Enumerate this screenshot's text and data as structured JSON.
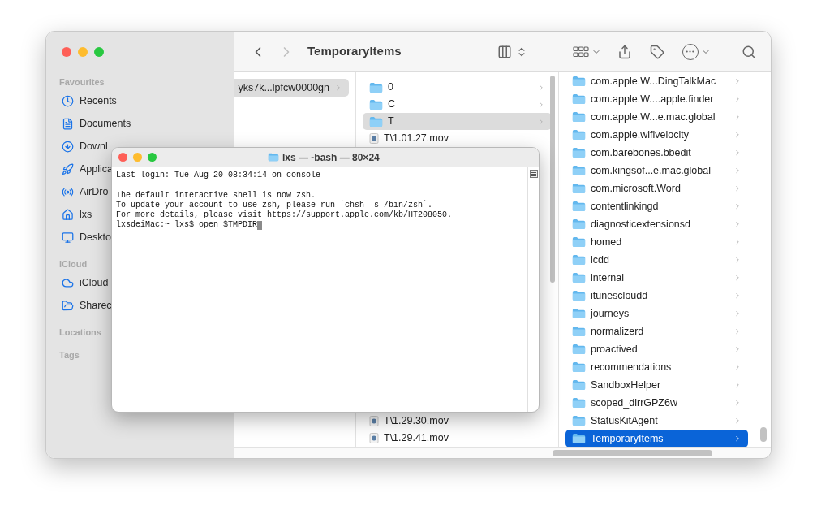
{
  "finder": {
    "title": "TemporaryItems",
    "forward_disabled": true,
    "sidebar": [
      {
        "heading": "Favourites",
        "items": [
          {
            "label": "Recents",
            "kind": "recents"
          },
          {
            "label": "Documents",
            "kind": "document"
          },
          {
            "label": "Downl",
            "kind": "download"
          },
          {
            "label": "Applica",
            "kind": "apps"
          },
          {
            "label": "AirDro",
            "kind": "airdrop"
          },
          {
            "label": "lxs",
            "kind": "home"
          },
          {
            "label": "Deskto",
            "kind": "desktop"
          }
        ]
      },
      {
        "heading": "iCloud",
        "items": [
          {
            "label": "iCloud",
            "kind": "cloud"
          },
          {
            "label": "Sharec",
            "kind": "shared"
          }
        ]
      },
      {
        "heading": "Locations"
      },
      {
        "heading": "Tags"
      }
    ],
    "columns": [
      {
        "focused": false,
        "top": [
          {
            "label": "yks7k...lpfcw0000gn",
            "kind": "path",
            "selected": true
          }
        ]
      },
      {
        "focused": false,
        "top": [
          {
            "label": "0",
            "kind": "folder",
            "selected": false
          },
          {
            "label": "C",
            "kind": "folder",
            "selected": false
          },
          {
            "label": "T",
            "kind": "folder",
            "selected": true
          },
          {
            "label": "T\\1.01.27.mov",
            "kind": "movie",
            "selected": false
          }
        ],
        "bottom": [
          {
            "label": "T\\1.29.30.mov",
            "kind": "movie",
            "selected": false
          },
          {
            "label": "T\\1.29.41.mov",
            "kind": "movie",
            "selected": false
          }
        ]
      },
      {
        "focused": true,
        "top": [
          {
            "label": "com.apple.W...DingTalkMac",
            "kind": "folder",
            "selected": false
          },
          {
            "label": "com.apple.W....apple.finder",
            "kind": "folder",
            "selected": false
          },
          {
            "label": "com.apple.W...e.mac.global",
            "kind": "folder",
            "selected": false
          },
          {
            "label": "com.apple.wifivelocity",
            "kind": "folder",
            "selected": false
          },
          {
            "label": "com.barebones.bbedit",
            "kind": "folder",
            "selected": false
          },
          {
            "label": "com.kingsof...e.mac.global",
            "kind": "folder",
            "selected": false
          },
          {
            "label": "com.microsoft.Word",
            "kind": "folder",
            "selected": false
          },
          {
            "label": "contentlinkingd",
            "kind": "folder",
            "selected": false
          },
          {
            "label": "diagnosticextensionsd",
            "kind": "folder",
            "selected": false
          },
          {
            "label": "homed",
            "kind": "folder",
            "selected": false
          },
          {
            "label": "icdd",
            "kind": "folder",
            "selected": false
          },
          {
            "label": "internal",
            "kind": "folder",
            "selected": false
          },
          {
            "label": "itunescloudd",
            "kind": "folder",
            "selected": false
          },
          {
            "label": "journeys",
            "kind": "folder",
            "selected": false
          },
          {
            "label": "normalizerd",
            "kind": "folder",
            "selected": false
          },
          {
            "label": "proactived",
            "kind": "folder",
            "selected": false
          },
          {
            "label": "recommendations",
            "kind": "folder",
            "selected": false
          },
          {
            "label": "SandboxHelper",
            "kind": "folder",
            "selected": false
          },
          {
            "label": "scoped_dirrGPZ6w",
            "kind": "folder",
            "selected": false
          },
          {
            "label": "StatusKitAgent",
            "kind": "folder",
            "selected": false
          },
          {
            "label": "TemporaryItems",
            "kind": "folder",
            "selected": true
          }
        ]
      }
    ]
  },
  "terminal": {
    "title": "lxs — -bash — 80×24",
    "blocks": [
      [
        "Last login: Tue Aug 20 08:34:14 on console"
      ],
      [
        "The default interactive shell is now zsh.",
        "To update your account to use zsh, please run `chsh -s /bin/zsh`.",
        "For more details, please visit https://support.apple.com/kb/HT208050.",
        "lxsdeiMac:~ lxs$ open $TMPDIR"
      ]
    ],
    "cursor": true
  }
}
